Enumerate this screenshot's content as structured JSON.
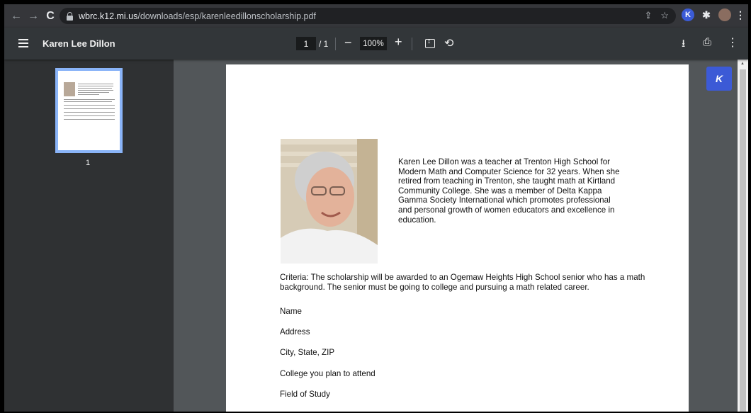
{
  "browser": {
    "url_host": "wbrc.k12.mi.us",
    "url_path": "/downloads/esp/karenleedillonscholarship.pdf"
  },
  "toolbar": {
    "title": "Karen Lee Dillon",
    "page_current": "1",
    "page_total": "/ 1",
    "zoom": "100%"
  },
  "sidebar": {
    "thumbnail_label": "1"
  },
  "document": {
    "bio": "Karen Lee Dillon was a teacher at Trenton High School for Modern Math and Computer Science for 32 years.  When she retired from teaching in Trenton, she taught math at Kirtland Community College.  She was a member of Delta Kappa Gamma Society International which promotes professional and personal growth of women educators and excellence in education.",
    "criteria": "Criteria:  The scholarship will be awarded to an Ogemaw Heights High School senior who has a math background.  The senior must be going to college and pursuing a math related career.",
    "fields": [
      {
        "label": "Name"
      },
      {
        "label": "Address"
      },
      {
        "label": "City, State, ZIP"
      },
      {
        "label": "College you plan to attend"
      },
      {
        "label": "Field of Study"
      }
    ]
  },
  "extension": {
    "k_label": "K"
  },
  "colors": {
    "toolbar_bg": "#323639",
    "viewer_bg": "#525659",
    "thumb_border": "#8ab4f8",
    "field_fill": "#e8ebff",
    "extension_blue": "#3c5ad6"
  }
}
